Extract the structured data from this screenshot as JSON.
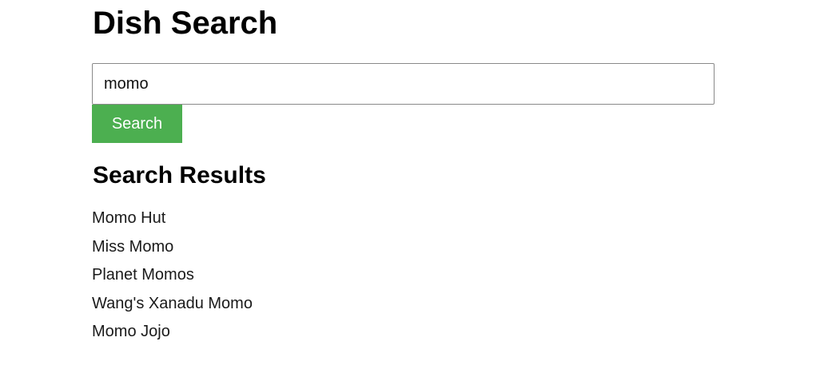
{
  "page": {
    "title": "Dish Search"
  },
  "search": {
    "value": "momo",
    "button_label": "Search"
  },
  "results": {
    "heading": "Search Results",
    "items": [
      "Momo Hut",
      "Miss Momo",
      "Planet Momos",
      "Wang's Xanadu Momo",
      "Momo Jojo"
    ]
  },
  "colors": {
    "button_bg": "#4caf50",
    "button_text": "#ffffff",
    "input_border": "#8a8a8a"
  }
}
